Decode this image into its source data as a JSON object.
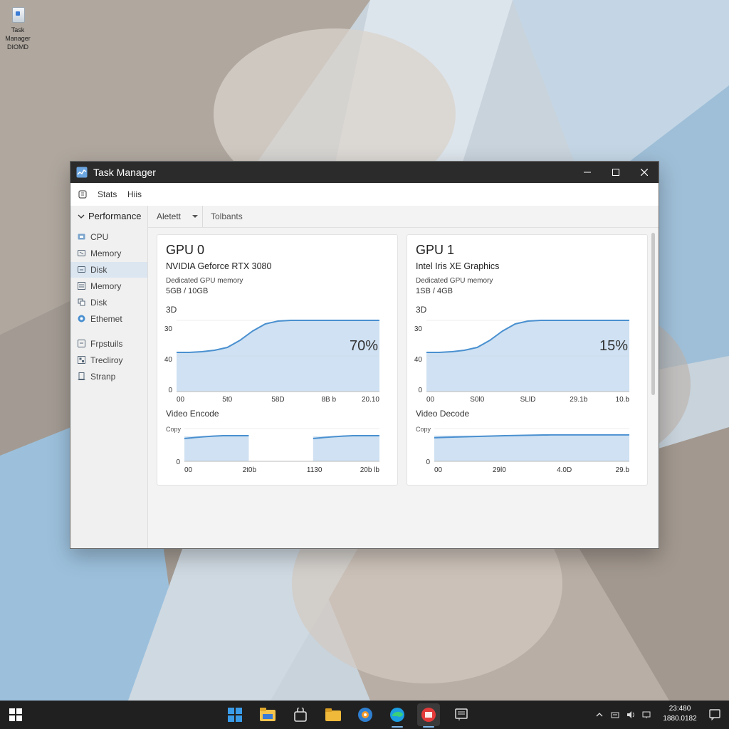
{
  "desktop": {
    "icon_label_1": "Task Manager",
    "icon_label_2": "DIOMD"
  },
  "window": {
    "title": "Task Manager",
    "menu": [
      "Stats",
      "Hiis"
    ],
    "sidebar": {
      "header": "Performance",
      "items": [
        {
          "label": "CPU",
          "icon": "cpu-icon"
        },
        {
          "label": "Memory",
          "icon": "memory-icon"
        },
        {
          "label": "Disk",
          "icon": "disk-icon",
          "active": true
        },
        {
          "label": "Memory",
          "icon": "memory-icon"
        },
        {
          "label": "Disk",
          "icon": "disk-icon"
        },
        {
          "label": "Ethemet",
          "icon": "ethernet-icon"
        },
        {
          "label": "Frpstuils",
          "icon": "app-icon"
        },
        {
          "label": "Trecliroy",
          "icon": "history-icon"
        },
        {
          "label": "Stranp",
          "icon": "startup-icon"
        }
      ]
    },
    "toolbar": {
      "dropdown_label": "Aletett",
      "tab2_label": "Tolbants"
    }
  },
  "gpus": [
    {
      "title": "GPU 0",
      "name": "NVIDIA Geforce RTX 3080",
      "memory_label": "Dedicated GPU memory",
      "memory_value": "5GB / 10GB",
      "engine_label": "3D",
      "utilization": "70%",
      "y_ticks": [
        "30",
        "40",
        "0"
      ],
      "x_ticks": [
        "00",
        "5t0",
        "58D",
        "8B b",
        "20.10"
      ],
      "curve": [
        0.55,
        0.55,
        0.56,
        0.58,
        0.62,
        0.72,
        0.85,
        0.95,
        0.99,
        1.0,
        1.0,
        1.0,
        1.0,
        1.0,
        1.0,
        1.0,
        1.0
      ],
      "section2": "Video Encode",
      "copy_label": "Copy",
      "copy_y_tick": "0",
      "copy_x_ticks": [
        "00",
        "2t0b",
        "1130",
        "20b lb"
      ],
      "copy_segments": [
        [
          0.0,
          0.33
        ],
        [
          0.66,
          1.0
        ]
      ],
      "copy_level": 0.92
    },
    {
      "title": "GPU 1",
      "name": "Intel Iris XE Graphics",
      "memory_label": "Dedicated GPU memory",
      "memory_value": "1SB / 4GB",
      "engine_label": "3D",
      "utilization": "15%",
      "y_ticks": [
        "30",
        "40",
        "0"
      ],
      "x_ticks": [
        "00",
        "S0l0",
        "SLlD",
        "29.1b",
        "10.b"
      ],
      "curve": [
        0.55,
        0.55,
        0.56,
        0.58,
        0.62,
        0.72,
        0.85,
        0.95,
        0.99,
        1.0,
        1.0,
        1.0,
        1.0,
        1.0,
        1.0,
        1.0,
        1.0
      ],
      "section2": "Video Decode",
      "copy_label": "Copy",
      "copy_y_tick": "0",
      "copy_x_ticks": [
        "00",
        "29l0",
        "4.0D",
        "29.b"
      ],
      "copy_segments": [
        [
          0.0,
          1.0
        ]
      ],
      "copy_level": 0.95
    }
  ],
  "taskbar": {
    "icons": [
      "start-icon",
      "widgets-icon",
      "file-explorer-icon",
      "store-icon",
      "folder-icon",
      "media-icon",
      "edge-icon",
      "app-red-icon",
      "notes-icon"
    ],
    "clock_line1": "23:480",
    "clock_line2": "1880.0182"
  },
  "colors": {
    "accent": "#4a90d0",
    "fill": "#c7dcf0",
    "titlebar": "#2b2b2b",
    "taskbar": "#202020"
  }
}
